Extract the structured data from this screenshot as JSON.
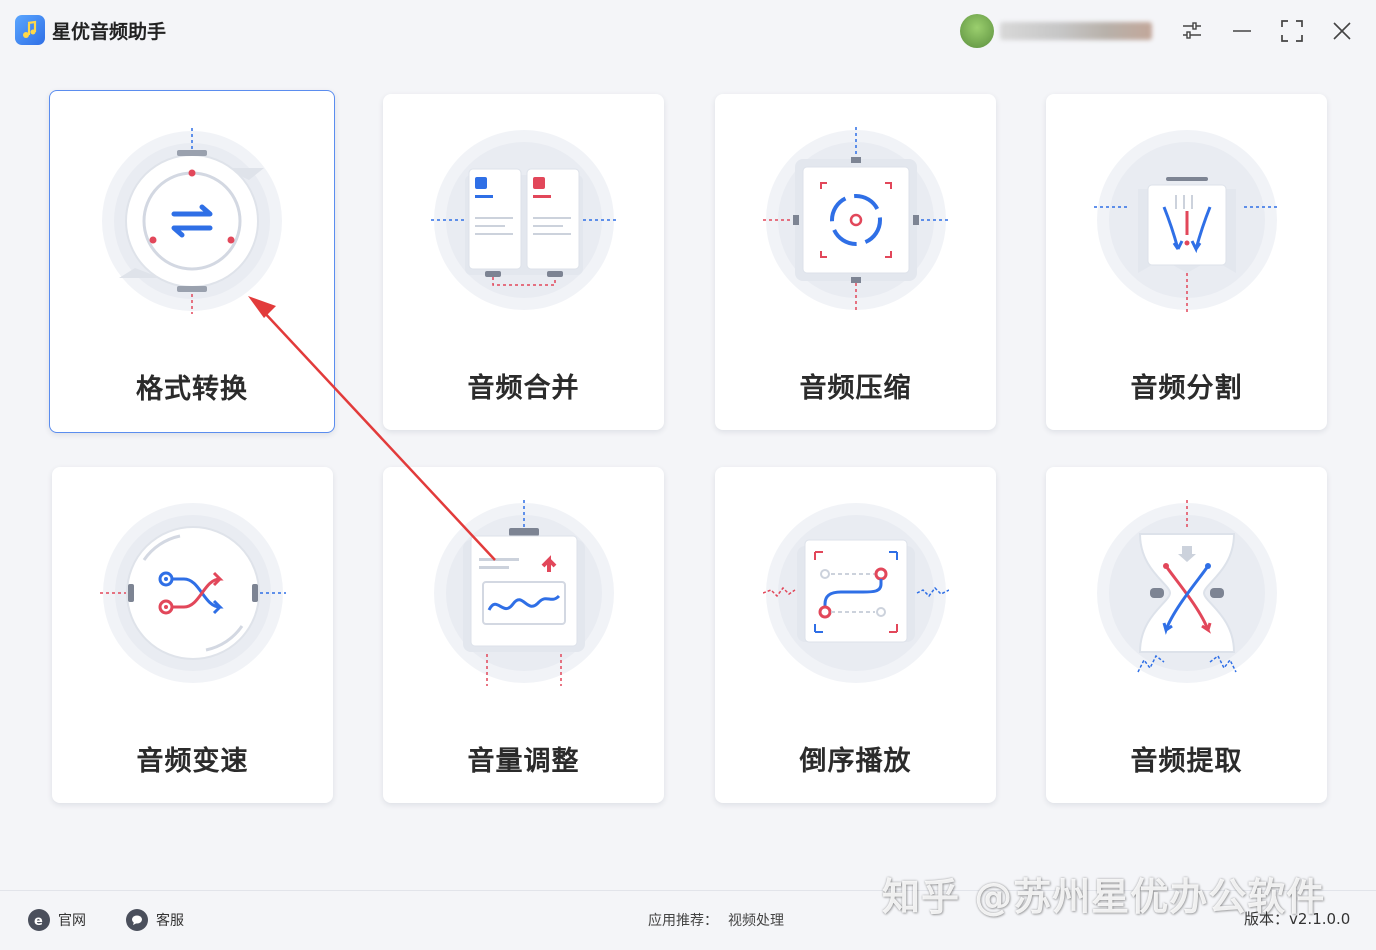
{
  "app": {
    "title": "星优音频助手"
  },
  "header": {
    "avatar": "user-avatar",
    "username": ""
  },
  "cards": [
    {
      "label": "格式转换",
      "icon": "format-convert-icon"
    },
    {
      "label": "音频合并",
      "icon": "audio-merge-icon"
    },
    {
      "label": "音频压缩",
      "icon": "audio-compress-icon"
    },
    {
      "label": "音频分割",
      "icon": "audio-split-icon"
    },
    {
      "label": "音频变速",
      "icon": "audio-speed-icon"
    },
    {
      "label": "音量调整",
      "icon": "volume-adjust-icon"
    },
    {
      "label": "倒序播放",
      "icon": "reverse-play-icon"
    },
    {
      "label": "音频提取",
      "icon": "audio-extract-icon"
    }
  ],
  "footer": {
    "official_site": "官网",
    "customer_service": "客服",
    "recommend_label": "应用推荐：",
    "recommend_link": "视频处理",
    "version": "版本：v2.1.0.0"
  },
  "watermark": "知乎 @苏州星优办公软件",
  "colors": {
    "accent": "#2f6fe6",
    "red": "#e2475a",
    "active_border": "#5b8def"
  }
}
